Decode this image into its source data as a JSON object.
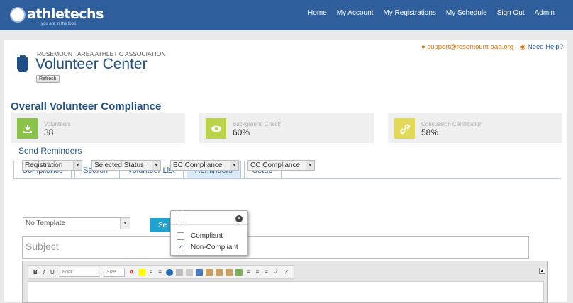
{
  "brand": {
    "name": "athletechs",
    "tagline": "you are in the loop"
  },
  "nav": [
    "Home",
    "My Account",
    "My Registrations",
    "My Schedule",
    "Sign Out",
    "Admin"
  ],
  "header": {
    "org": "ROSEMOUNT AREA ATHLETIC ASSOCIATION",
    "title": "Volunteer Center",
    "refresh": "Refresh",
    "support_email": "support@rosemount-aaa.org",
    "need_help": "Need Help?"
  },
  "compliance": {
    "title": "Overall Volunteer Compliance",
    "cards": [
      {
        "label": "Volunteers",
        "value": "38",
        "color": "#8bc34a",
        "icon": "download-icon"
      },
      {
        "label": "Background Check",
        "value": "60%",
        "color": "#b9d44a",
        "icon": "eye-icon"
      },
      {
        "label": "Concussion Certification",
        "value": "58%",
        "color": "#e3d959",
        "icon": "link-icon"
      }
    ]
  },
  "tabs": [
    "Compliance",
    "Search",
    "Volunteer List",
    "Reminders",
    "Setup"
  ],
  "active_tab": "Reminders",
  "reminders": {
    "title": "Send Reminders",
    "filters": [
      "Registration",
      "Selected Status",
      "BC Compliance",
      "CC Compliance"
    ],
    "template": "No Template",
    "send_label": "Se",
    "subject_placeholder": "Subject"
  },
  "editor": {
    "buttons": [
      "B",
      "I",
      "U"
    ],
    "font_label": "Font",
    "size_label": "Size"
  },
  "dropdown_popup": {
    "options": [
      {
        "label": "Compliant",
        "checked": false
      },
      {
        "label": "Non-Compliant",
        "checked": true
      }
    ]
  }
}
